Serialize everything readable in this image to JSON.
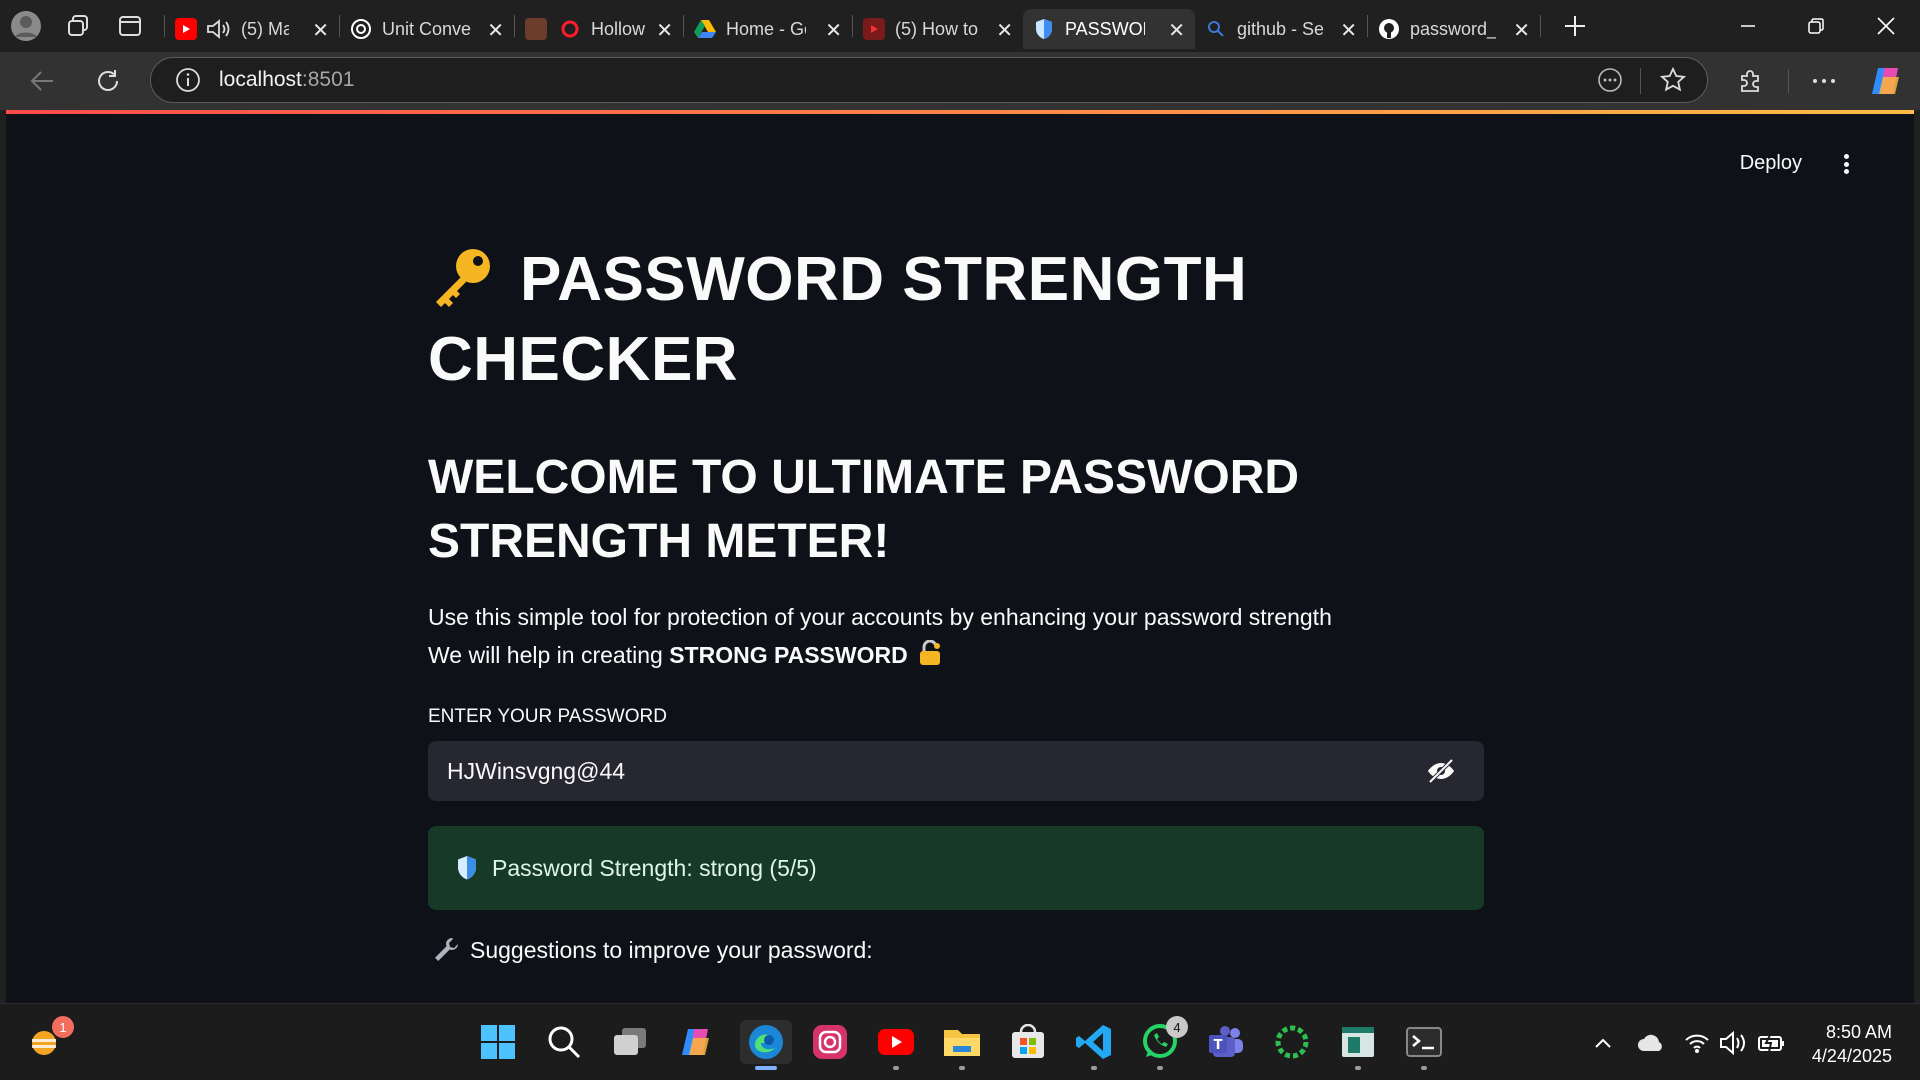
{
  "browser": {
    "tabs": [
      {
        "title": "(5) Ma",
        "favicon": "youtube-icon",
        "audio": true
      },
      {
        "title": "Unit Conve",
        "favicon": "openai-icon"
      },
      {
        "title": "Hollow",
        "favicon": "opera-icon"
      },
      {
        "title": "Home - Go",
        "favicon": "google-drive-icon"
      },
      {
        "title": "(5) How to",
        "favicon": "youtube-icon"
      },
      {
        "title": "PASSWOR",
        "favicon": "shield-icon",
        "active": true
      },
      {
        "title": "github - Se",
        "favicon": "search-icon"
      },
      {
        "title": "password_",
        "favicon": "github-icon"
      }
    ],
    "address": {
      "host": "localhost",
      "port": ":8501"
    }
  },
  "app": {
    "deploy_label": "Deploy",
    "title_line1": "PASSWORD STRENGTH",
    "title_line2": "CHECKER",
    "subtitle_line1": "WELCOME TO ULTIMATE PASSWORD",
    "subtitle_line2": "STRENGTH METER!",
    "description_line1": "Use this simple tool for protection of your accounts by enhancing your password strength",
    "description_line2_prefix": "We will help in creating ",
    "description_line2_bold": "STRONG PASSWORD",
    "input_label": "ENTER YOUR PASSWORD",
    "password_value": "HJWinsvgng@44",
    "strength_text": "Password Strength: strong (5/5)",
    "suggestions_heading": "Suggestions to improve your password:"
  },
  "taskbar": {
    "time": "8:50 AM",
    "date": "4/24/2025",
    "weather_badge": "1",
    "whatsapp_badge": "4"
  },
  "colors": {
    "app_bg": "#0e1117",
    "success_bg": "#173928",
    "input_bg": "#262730",
    "accent_gradient_start": "#ff4b4b",
    "accent_gradient_end": "#ffbd45"
  }
}
